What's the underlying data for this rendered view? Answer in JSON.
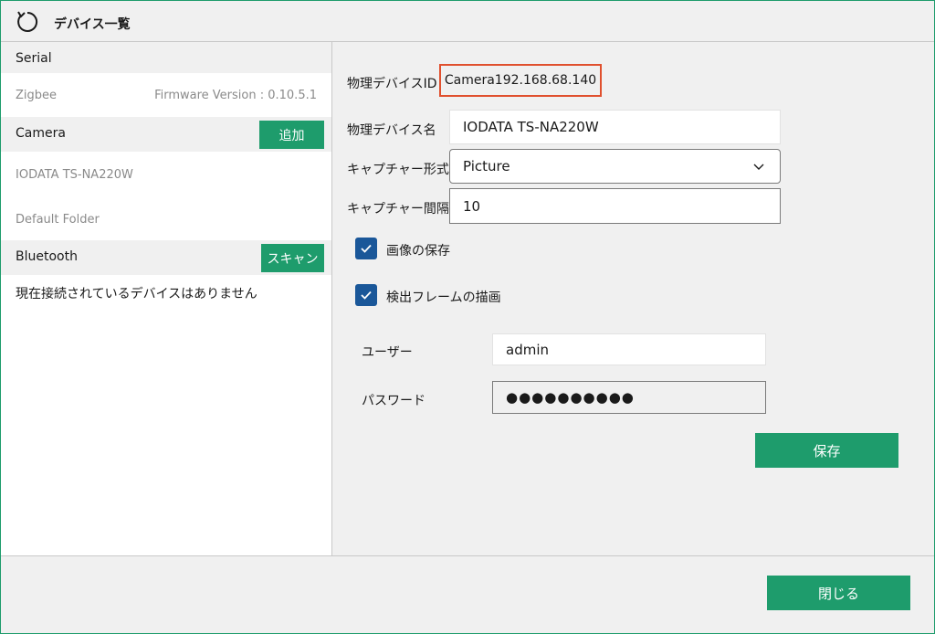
{
  "window": {
    "title": "デバイス一覧"
  },
  "left": {
    "serial": {
      "label": "Serial"
    },
    "zigbee": {
      "label": "Zigbee",
      "firmware": "Firmware Version : 0.10.5.1"
    },
    "camera": {
      "label": "Camera",
      "add_button": "追加",
      "device": "IODATA TS-NA220W",
      "folder": "Default Folder"
    },
    "bluetooth": {
      "label": "Bluetooth",
      "scan_button": "スキャン",
      "status": "現在接続されているデバイスはありません"
    }
  },
  "form": {
    "device_id_label": "物理デバイスID",
    "device_id": "Camera192.168.68.140",
    "device_name_label": "物理デバイス名",
    "device_name": "IODATA TS-NA220W",
    "capture_format_label": "キャプチャー形式",
    "capture_format": "Picture",
    "capture_interval_label": "キャプチャー間隔",
    "capture_interval": "10",
    "save_image_label": "画像の保存",
    "save_image_checked": true,
    "draw_frame_label": "検出フレームの描画",
    "draw_frame_checked": true,
    "user_label": "ユーザー",
    "user": "admin",
    "password_label": "パスワード",
    "password": "●●●●●●●●●●",
    "save_button": "保存"
  },
  "footer": {
    "close_button": "閉じる"
  },
  "colors": {
    "accent": "#1e9c6c",
    "checkbox": "#1a5799",
    "highlight": "#e0502e"
  }
}
